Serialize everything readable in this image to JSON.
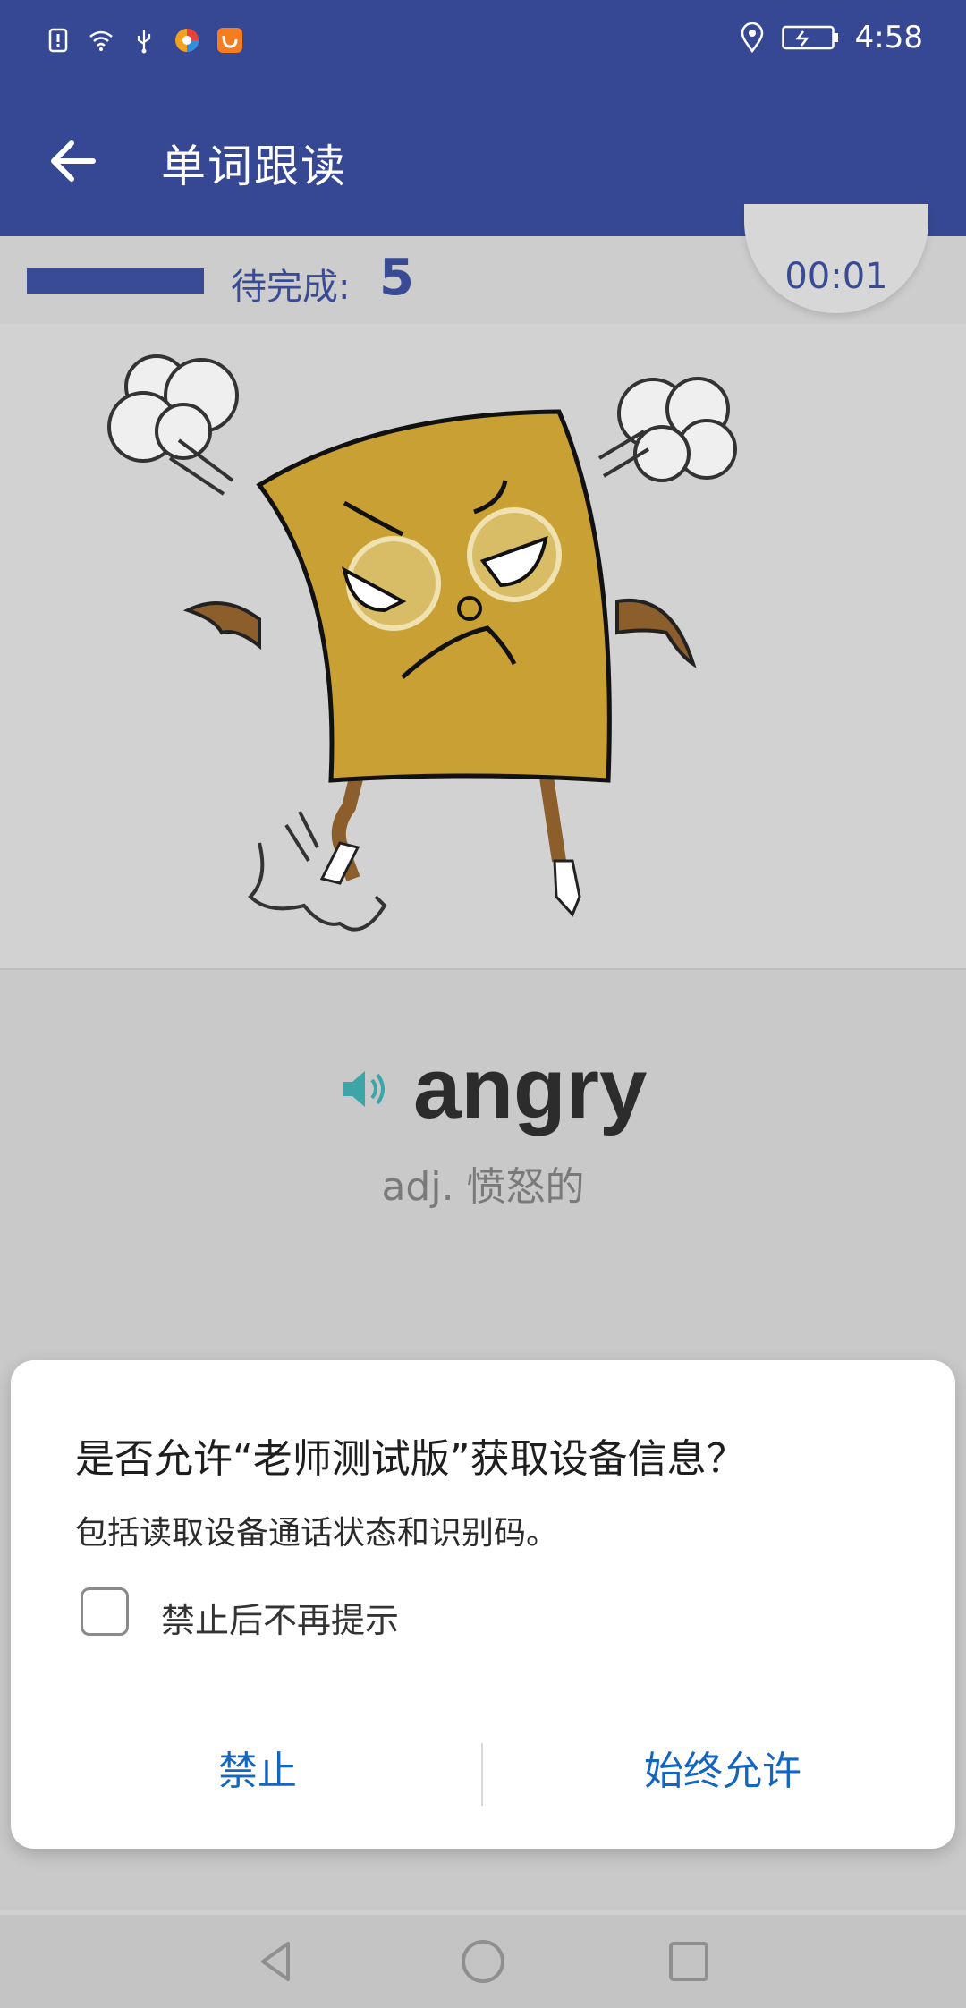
{
  "status_bar": {
    "time": "4:58",
    "icons": [
      "alert-icon",
      "wifi-icon",
      "usb-icon",
      "browser-app-icon",
      "uc-browser-icon",
      "location-icon",
      "battery-icon"
    ]
  },
  "app_bar": {
    "title": "单词跟读",
    "back_icon": "back-arrow-icon"
  },
  "progress": {
    "pending_label": "待完成:",
    "pending_count": "5",
    "timer": "00:01",
    "accent": "#364893"
  },
  "word_card": {
    "image": "angry-paper-character-illustration",
    "word": "angry",
    "meaning": "adj. 愤怒的",
    "speaker_color": "#3ba5a7"
  },
  "dialog": {
    "title": "是否允许“老师测试版”获取设备信息？",
    "subtitle": "包括读取设备通话状态和识别码。",
    "checkbox_label": "禁止后不再提示",
    "checkbox_checked": false,
    "deny_label": "禁止",
    "allow_label": "始终允许",
    "button_color": "#1465c0"
  },
  "nav_bar": {
    "icons": [
      "nav-back-icon",
      "nav-home-icon",
      "nav-recents-icon"
    ]
  }
}
